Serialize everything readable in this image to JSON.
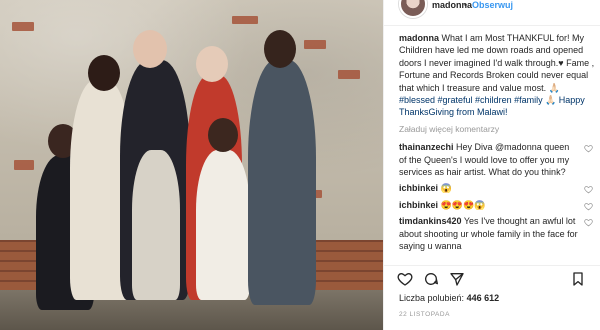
{
  "post": {
    "username": "madonna",
    "separator": "•",
    "follow_label": "Obserwuj"
  },
  "caption": {
    "user": "madonna",
    "text": "What I am Most THANKFUL for! My Children have led me down roads and opened doors I never imagined I'd walk through.♥ Fame , Fortune and Records Broken could never equal that which I treasure and value most. ",
    "tags_line": "🙏🏻 #blessed #grateful #children #family 🙏🏻 Happy ThanksGiving from Malawi!"
  },
  "load_more": "Załaduj więcej komentarzy",
  "comments": [
    {
      "user": "thainanzechi",
      "text": "Hey Diva @madonna queen of the Queen's I would love to offer you my services as hair artist. What do you think?"
    },
    {
      "user": "ichbinkei",
      "text": "😱"
    },
    {
      "user": "ichbinkei",
      "text": "😍😍😍😱"
    },
    {
      "user": "timdankins420",
      "text": "Yes I've thought an awful lot about shooting ur whole family in the face for saying u wanna"
    }
  ],
  "likes": {
    "label": "Liczba polubień:",
    "count": "446 612"
  },
  "date": "22 LISTOPADA",
  "icons": [
    "heart-icon",
    "comment-icon",
    "share-icon",
    "bookmark-icon"
  ]
}
